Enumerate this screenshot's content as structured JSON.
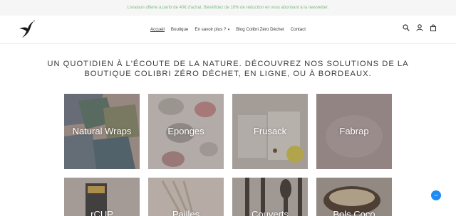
{
  "announcement": "Livraison offerte à partir de 40€ d'achat. Bénéficiez de 10% de réduction en vous abonnant à la newsletter.",
  "nav": {
    "items": [
      {
        "label": "Accueil",
        "active": true
      },
      {
        "label": "Boutique"
      },
      {
        "label": "En savoir plus ?",
        "dropdown": true
      },
      {
        "label": "Blog Colibri Zéro Déchet"
      },
      {
        "label": "Contact"
      }
    ]
  },
  "header_icons": [
    "search-icon",
    "account-icon",
    "cart-icon"
  ],
  "tagline": "UN QUOTIDIEN À L'ÉCOUTE DE LA NATURE. DÉCOUVREZ NOS SOLUTIONS DE LA BOUTIQUE COLIBRI ZÉRO DÉCHET, EN LIGNE, OU À BORDEAUX.",
  "collections": [
    {
      "label": "Natural Wraps"
    },
    {
      "label": "Eponges"
    },
    {
      "label": "Frusack"
    },
    {
      "label": "Fabrap"
    },
    {
      "label": "rCUP"
    },
    {
      "label": "Pailles"
    },
    {
      "label": "Couverts"
    },
    {
      "label": "Bols Coco"
    }
  ],
  "colors": {
    "announcement_text": "#7ebb82",
    "overlay": "#5a4e4e",
    "messenger": "#1c8bf5"
  }
}
